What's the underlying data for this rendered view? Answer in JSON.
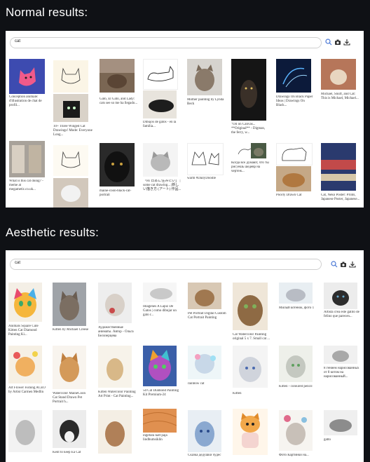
{
  "sections": {
    "normal_heading": "Normal results:",
    "aesthetic_heading": "Aesthetic results:"
  },
  "search": {
    "query": "cat",
    "icons": [
      "search-icon",
      "camera-icon",
      "download-icon"
    ]
  },
  "normal_captions": [
    "Conception animale: d'illustration de chat de profil...",
    "10+ Three Winged Cat Drawings! Mode: Everyone Long...",
    "Gato, El Gato, and Lady: cats see so me ha llegado...",
    "Dibujos de gatos - en la familia...",
    "Mother painting by Lynda Beck",
    "\"Oil on Canvas... **Original** - Digman, the ferry, w...",
    "Drawings On Black Paper Ideas | Drawings On Black...",
    "Michael, Snuff, and Cat: This is Michael, Michael...",
    "What is this cat doing? - meme at megametic.co.uk...",
    "maine-coon-black-cat-portrait",
    "「Hi 日本に住みたい」 | some cat drawing... |新しい描き方 (アート) 作品...",
    "warm #DailyDoodle",
    "Когда все думают, что ты рисуешь шедевр на чертеж...",
    "Poorly Drawn Cat",
    "Cat, Neko Poster: Prints, Japanese Poster, Japanese..."
  ],
  "aesthetic_captions": [
    "Animals Square Cute Kitten Cat Diamond Painting Ki...",
    "Kitten by Michael Creese",
    "Художественные аниматы. Автор - Ольга Белозерцева",
    "Imagenes A Lapiz De Gatos | como dibujar un gato r...",
    "Pet Portrait Digital Custom Cat Portrait Painting",
    "Cat Watercolor Painting original 5 x 7. Small cat ...",
    "Милый котенок, фото 1",
    "Artista crea este gatito de felino que parecen...",
    "Art Flower Fishing ACEO by Artist Carmen Medlin",
    "Watercolor MaineCoon Cat Stand Drawn Pet Portrait h...",
    "Kitten Watercolor Painting Art Print - Cat Painting...",
    "5d Cat Diamond Painting Kit Premium-24",
    "rainbow cat",
    "Kitten",
    "Kitten - coloured pencil",
    "8 гением нарисованных от 8 котом на нарисованный...",
    "ingefara katt paja lindbumsiklin",
    "Сказка дедушки чудес",
    "Фото Картинки на...",
    "Kent to keep Ea Cat",
    "gatto"
  ]
}
